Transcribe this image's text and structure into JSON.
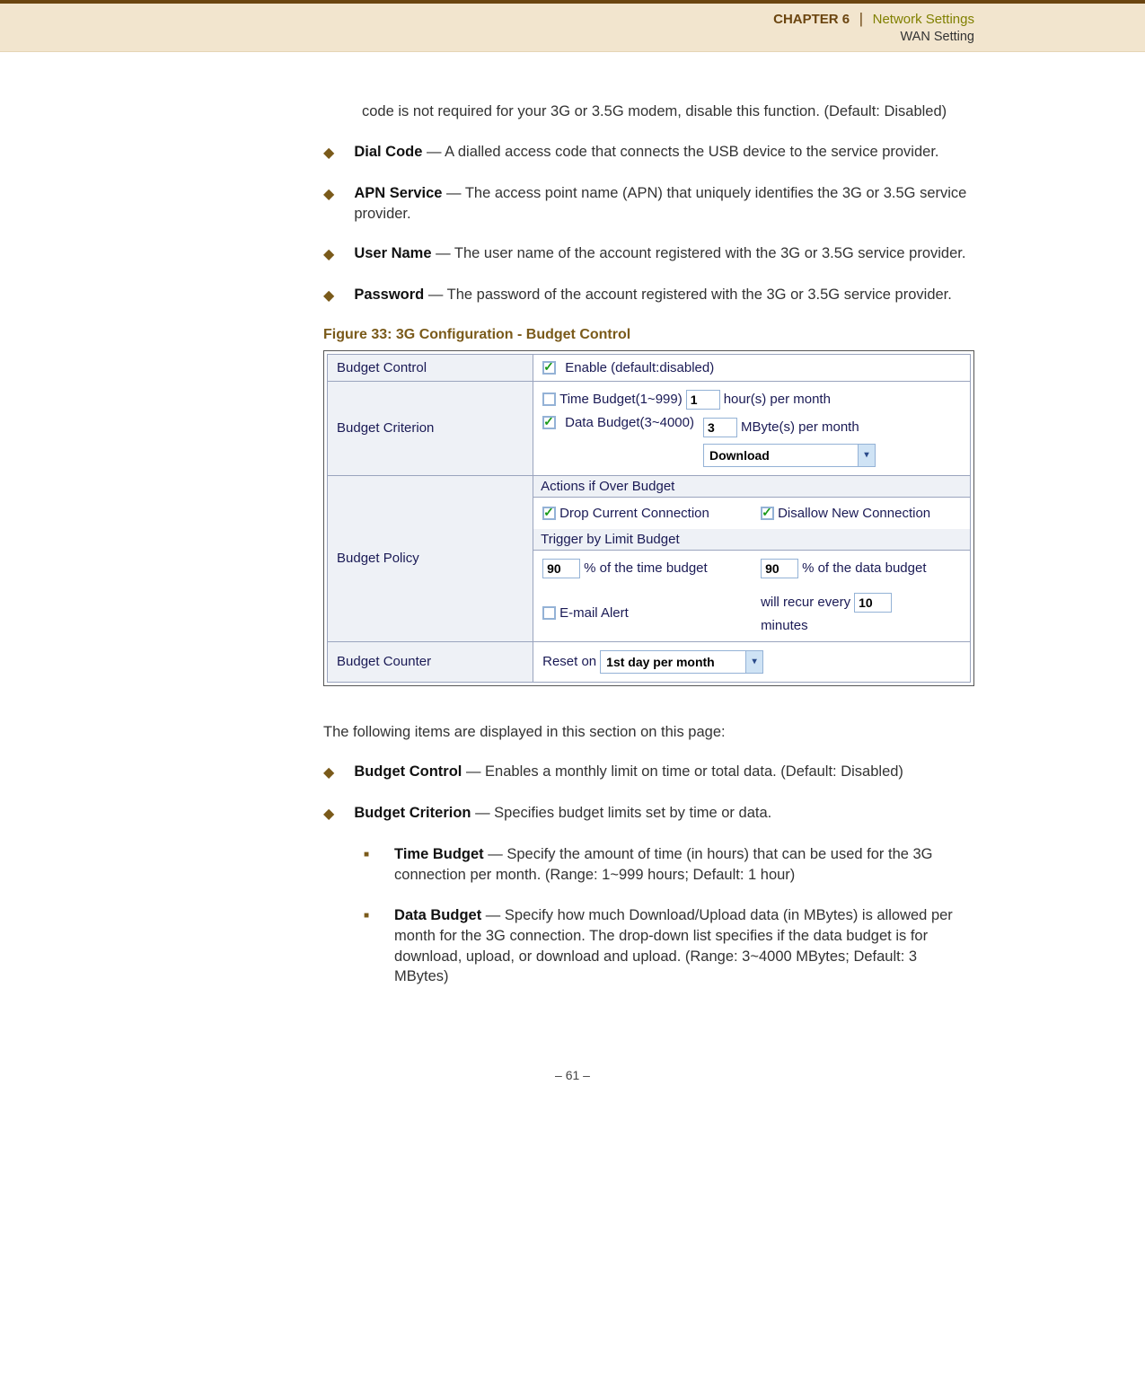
{
  "header": {
    "chapter": "CHAPTER 6",
    "separator": "|",
    "section": "Network Settings",
    "sub": "WAN Setting"
  },
  "intro_para": "code is not required for your 3G or 3.5G modem, disable this function. (Default: Disabled)",
  "top_bullets": [
    {
      "term": "Dial Code",
      "desc": " — A dialled access code that connects the USB device to the service provider."
    },
    {
      "term": "APN Service",
      "desc": " — The access point name (APN) that uniquely identifies the 3G or 3.5G service provider."
    },
    {
      "term": "User Name",
      "desc": " — The user name of the account registered with the 3G or 3.5G service provider."
    },
    {
      "term": "Password",
      "desc": " — The password of the account registered with the 3G or 3.5G service provider."
    }
  ],
  "figure_caption": "Figure 33:  3G Configuration - Budget Control",
  "table": {
    "row1_label": "Budget Control",
    "row1_cb_text": "Enable (default:disabled)",
    "row2_label": "Budget Criterion",
    "row2_time_cb": "Time Budget(1~999)",
    "row2_time_val": "1",
    "row2_time_suffix": "hour(s) per month",
    "row2_data_cb": "Data Budget(3~4000)",
    "row2_data_val": "3",
    "row2_data_suffix": "MByte(s) per month",
    "row2_select": "Download",
    "row3_label": "Budget Policy",
    "row3_head1": "Actions if Over Budget",
    "row3_drop": "Drop Current Connection",
    "row3_disallow": "Disallow New Connection",
    "row3_head2": "Trigger by Limit Budget",
    "row3_pct_time_val": "90",
    "row3_pct_time_txt": "% of the time budget",
    "row3_pct_data_val": "90",
    "row3_pct_data_txt": "% of the data budget",
    "row3_email": "E-mail Alert",
    "row3_recur_pre": "will recur every",
    "row3_recur_val": "10",
    "row3_recur_post": "minutes",
    "row4_label": "Budget Counter",
    "row4_pre": "Reset on",
    "row4_select": "1st day per month"
  },
  "post_para": "The following items are displayed in this section on this page:",
  "post_bullets": [
    {
      "term": "Budget Control",
      "desc": " — Enables a monthly limit on time or total data. (Default: Disabled)"
    },
    {
      "term": "Budget Criterion",
      "desc": " — Specifies budget limits set by time or data."
    }
  ],
  "sub_bullets": [
    {
      "term": "Time Budget",
      "desc": " — Specify the amount of time (in hours) that can be used for the 3G connection per month. (Range: 1~999 hours; Default: 1 hour)"
    },
    {
      "term": "Data Budget",
      "desc": " — Specify how much Download/Upload data (in MBytes) is allowed per month for the 3G connection. The drop-down list specifies if the data budget is for download, upload, or download and upload. (Range: 3~4000 MBytes; Default: 3 MBytes)"
    }
  ],
  "footer": "–  61  –"
}
